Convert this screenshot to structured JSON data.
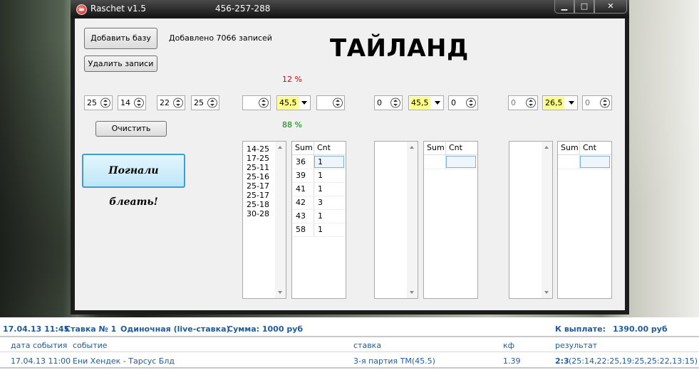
{
  "window": {
    "title": "Raschet v1.5",
    "phone": "456-257-288",
    "buttons": {
      "minimize": "▁",
      "maximize": "□",
      "close": "✕"
    }
  },
  "left_panel": {
    "add_base_label": "Добавить базу",
    "added_text": "Добавлено 7066 записей",
    "delete_label": "Удалить записи",
    "clear_label": "Очистить",
    "go_label": "Погнали блеать!",
    "spinners": [
      "25",
      "14",
      "22",
      "25"
    ]
  },
  "title": "ТАЙЛАНД",
  "percent_top": "12 %",
  "percent_bottom": "88 %",
  "colors": {
    "percent_top": "#e00000",
    "percent_bottom": "#008000",
    "highlight": "#ffff84",
    "link_blue": "#1f5b9a"
  },
  "groups": [
    {
      "left_spin": "",
      "combo": "45,5",
      "right_spin": "",
      "list_items": [
        "14-25",
        "17-25",
        "25-11",
        "25-16",
        "25-17",
        "25-17",
        "25-18",
        "30-28"
      ],
      "grid_headers": [
        "Sum",
        "Cnt"
      ],
      "grid_rows": [
        [
          "36",
          "1"
        ],
        [
          "39",
          "1"
        ],
        [
          "41",
          "1"
        ],
        [
          "42",
          "3"
        ],
        [
          "43",
          "1"
        ],
        [
          "58",
          "1"
        ]
      ]
    },
    {
      "left_spin": "0",
      "combo": "45,5",
      "right_spin": "0",
      "list_items": [],
      "grid_headers": [
        "Sum",
        "Cnt"
      ],
      "grid_rows": []
    },
    {
      "left_spin": "0",
      "combo": "26,5",
      "right_spin": "0",
      "list_items": [],
      "grid_headers": [
        "Sum",
        "Cnt"
      ],
      "grid_rows": []
    }
  ],
  "bet": {
    "datetime": "17.04.13 11:45",
    "number": "Ставка № 1",
    "kind": "Одиночная (live-ставка)",
    "sum": "Сумма: 1000 руб",
    "payout_label": "К выплате:",
    "payout_value": "1390.00 руб",
    "columns": {
      "date": "дата события",
      "event": "событие",
      "stake": "ставка",
      "kf": "кф",
      "result": "результат"
    },
    "row": {
      "date": "17.04.13 11:00",
      "event": "Ени Хендек - Тарсус Блд",
      "stake": "3-я партия ТМ(45.5)",
      "kf": "1.39",
      "result_score": "2:3",
      "result_detail": "(25:14,22:25,19:25,25:22,13:15)"
    }
  }
}
